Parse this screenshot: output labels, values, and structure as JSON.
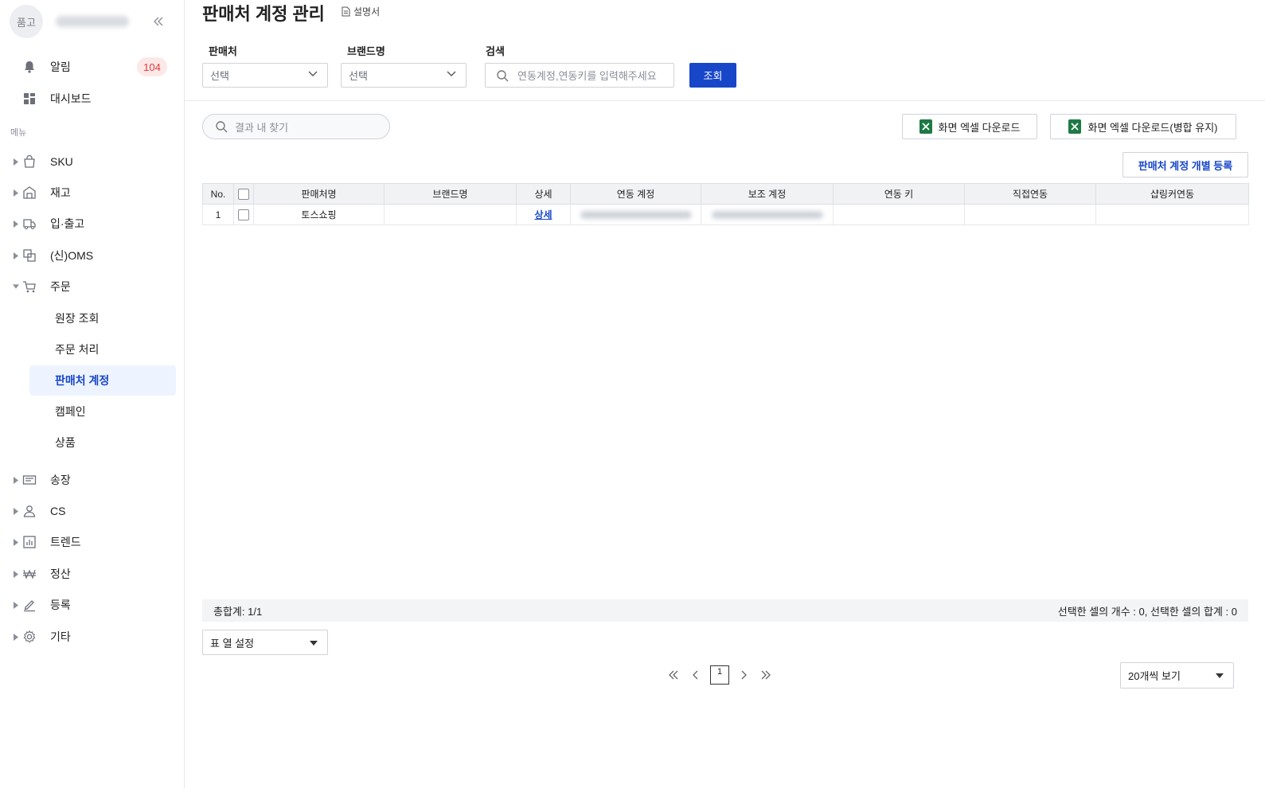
{
  "sidebar": {
    "avatar_text": "품고",
    "collapse_label": "«",
    "alarm": {
      "label": "알림",
      "count": "104"
    },
    "dashboard": {
      "label": "대시보드"
    },
    "menu_label": "메뉴",
    "items": [
      {
        "label": "SKU",
        "icon": "shopping-bag-icon"
      },
      {
        "label": "재고",
        "icon": "warehouse-icon"
      },
      {
        "label": "입·출고",
        "icon": "truck-icon"
      },
      {
        "label": "(신)OMS",
        "icon": "swap-box-icon"
      },
      {
        "label": "주문",
        "icon": "cart-icon"
      }
    ],
    "order_sub": [
      {
        "label": "원장 조회"
      },
      {
        "label": "주문 처리"
      },
      {
        "label": "판매처 계정"
      },
      {
        "label": "캠페인"
      },
      {
        "label": "상품"
      }
    ],
    "items_bottom": [
      {
        "label": "송장",
        "icon": "invoice-icon"
      },
      {
        "label": "CS",
        "icon": "person-icon"
      },
      {
        "label": "트렌드",
        "icon": "bar-chart-icon"
      },
      {
        "label": "정산",
        "icon": "won-icon"
      },
      {
        "label": "등록",
        "icon": "pencil-icon"
      },
      {
        "label": "기타",
        "icon": "gear-icon"
      }
    ]
  },
  "header": {
    "title": "판매처 계정 관리",
    "manual_label": "설명서"
  },
  "filters": {
    "seller_label": "판매처",
    "seller_value": "선택",
    "brand_label": "브랜드명",
    "brand_value": "선택",
    "search_label": "검색",
    "search_placeholder": "연동계정,연동키를 입력해주세요",
    "query_button": "조회"
  },
  "toolbar": {
    "find_placeholder": "결과 내 찾기",
    "excel_download": "화면 엑셀 다운로드",
    "excel_download_merge": "화면 엑셀 다운로드(병합 유지)",
    "register_button": "판매처 계정 개별 등록"
  },
  "table": {
    "headers": [
      "No.",
      "",
      "판매처명",
      "브랜드명",
      "상세",
      "연동 계정",
      "보조 계정",
      "연동 키",
      "직접연동",
      "샵링커연동"
    ],
    "rows": [
      {
        "no": "1",
        "seller": "토스쇼핑",
        "brand": "",
        "detail": "상세",
        "key": "",
        "direct": "",
        "shoplinker": ""
      }
    ]
  },
  "footer": {
    "total": "총합계: 1/1",
    "selection_info": "선택한 셀의 개수 : 0, 선택한 셀의 합계 : 0",
    "column_setting": "표 열 설정",
    "current_page": "1",
    "per_page": "20개씩 보기"
  }
}
